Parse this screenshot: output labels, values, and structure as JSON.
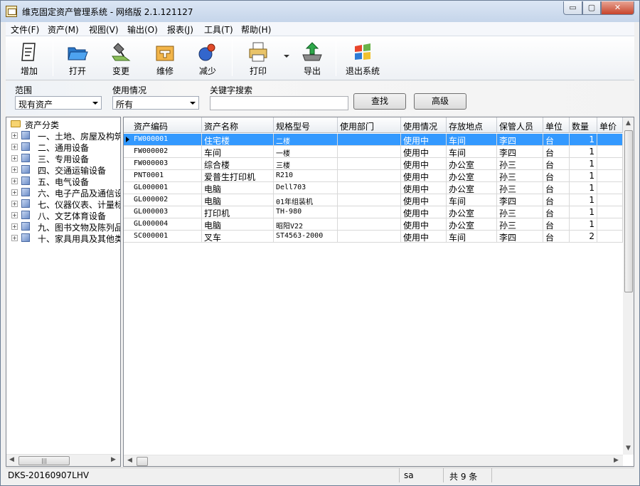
{
  "window": {
    "title": "维克固定资产管理系统 - 网络版 2.1.121127",
    "controls": {
      "minimize": "▭",
      "maximize": "▢",
      "close": "✕"
    }
  },
  "menu": [
    "文件(F)",
    "资产(M)",
    "视图(V)",
    "输出(O)",
    "报表(J)",
    "工具(T)",
    "帮助(H)"
  ],
  "toolbar": {
    "add": "增加",
    "open": "打开",
    "change": "变更",
    "repair": "维修",
    "reduce": "减少",
    "print": "打印",
    "export": "导出",
    "exit": "退出系统"
  },
  "filters": {
    "scope_label": "范围",
    "scope_value": "现有资产",
    "usage_label": "使用情况",
    "usage_value": "所有",
    "keyword_label": "关键字搜索",
    "keyword_value": "",
    "search_button": "查找",
    "advanced_button": "高级"
  },
  "tree": {
    "root": "资产分类",
    "items": [
      "一、土地、房屋及构筑",
      "二、通用设备",
      "三、专用设备",
      "四、交通运输设备",
      "五、电气设备",
      "六、电子产品及通信设",
      "七、仪器仪表、计量标",
      "八、文艺体育设备",
      "九、图书文物及陈列品",
      "十、家具用具及其他类"
    ]
  },
  "table": {
    "columns": [
      "资产编码",
      "资产名称",
      "规格型号",
      "使用部门",
      "使用情况",
      "存放地点",
      "保管人员",
      "单位",
      "数量",
      "单价"
    ],
    "rows": [
      [
        "FW000001",
        "住宅楼",
        "二楼",
        "",
        "使用中",
        "车间",
        "李四",
        "台",
        "1",
        ""
      ],
      [
        "FW000002",
        "车间",
        "一楼",
        "",
        "使用中",
        "车间",
        "李四",
        "台",
        "1",
        ""
      ],
      [
        "FW000003",
        "综合楼",
        "三楼",
        "",
        "使用中",
        "办公室",
        "孙三",
        "台",
        "1",
        ""
      ],
      [
        "PNT0001",
        "爱普生打印机",
        "R210",
        "",
        "使用中",
        "办公室",
        "孙三",
        "台",
        "1",
        ""
      ],
      [
        "GL000001",
        "电脑",
        "Dell703",
        "",
        "使用中",
        "办公室",
        "孙三",
        "台",
        "1",
        ""
      ],
      [
        "GL000002",
        "电脑",
        "01年组装机",
        "",
        "使用中",
        "车间",
        "李四",
        "台",
        "1",
        ""
      ],
      [
        "GL000003",
        "打印机",
        "TH-980",
        "",
        "使用中",
        "办公室",
        "孙三",
        "台",
        "1",
        ""
      ],
      [
        "GL000004",
        "电脑",
        "昭阳V22",
        "",
        "使用中",
        "办公室",
        "孙三",
        "台",
        "1",
        ""
      ],
      [
        "SC000001",
        "叉车",
        "ST4563-2000",
        "",
        "使用中",
        "车间",
        "李四",
        "台",
        "2",
        ""
      ]
    ],
    "selected_row": 0
  },
  "status": {
    "computer": "DKS-20160907LHV",
    "user": "sa",
    "count": "共 9 条"
  },
  "colors": {
    "selection": "#3399ff",
    "close_button": "#c7442b"
  }
}
